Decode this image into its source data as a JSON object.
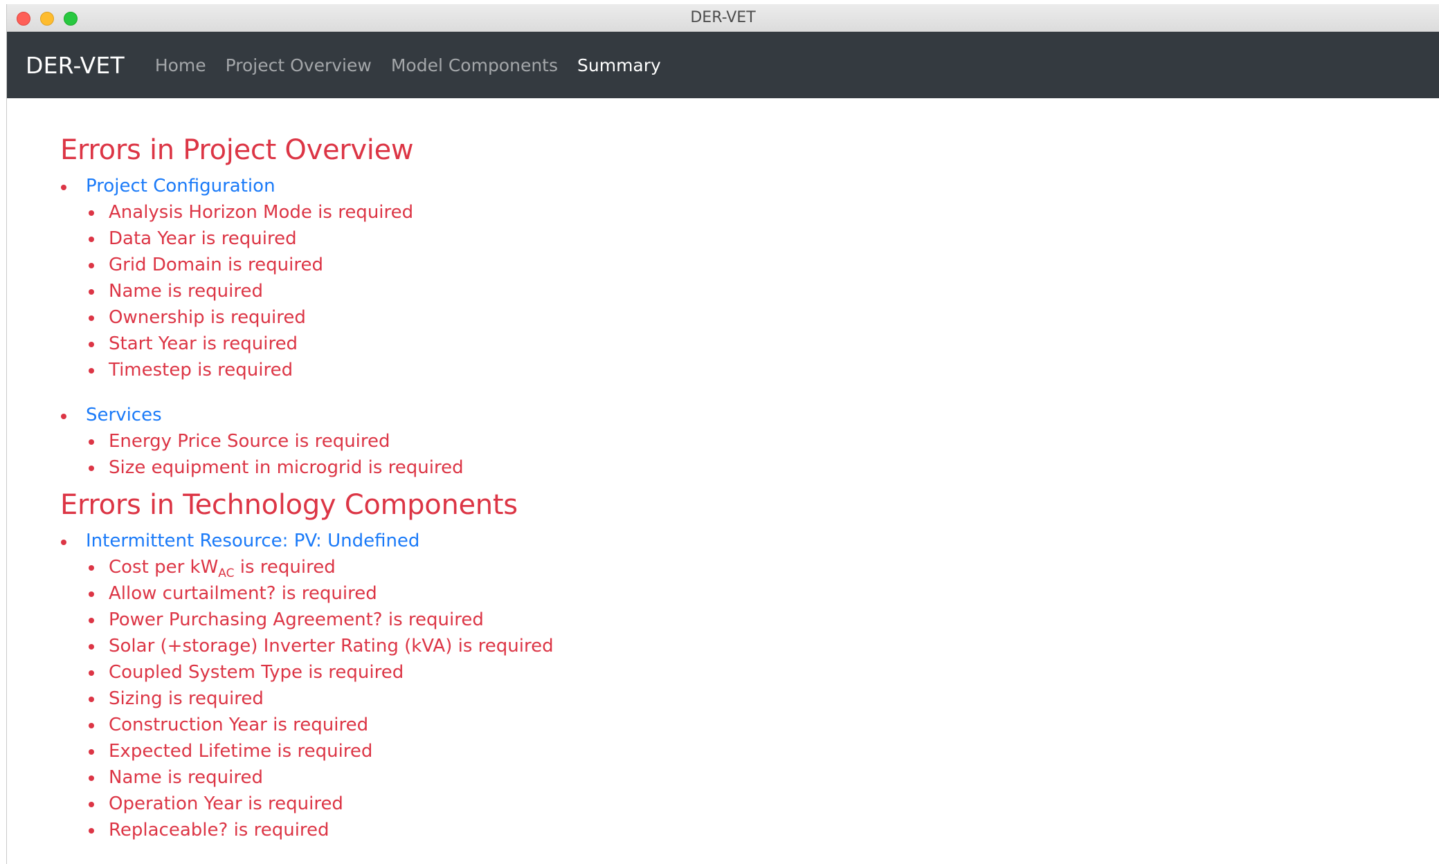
{
  "window": {
    "title": "DER-VET"
  },
  "navbar": {
    "brand": "DER-VET",
    "links": [
      "Home",
      "Project Overview",
      "Model Components",
      "Summary"
    ],
    "active": "Summary"
  },
  "project_overview": {
    "heading": "Errors in Project Overview",
    "sections": [
      {
        "name": "Project Configuration",
        "errors": [
          "Analysis Horizon Mode is required",
          "Data Year is required",
          "Grid Domain is required",
          "Name is required",
          "Ownership is required",
          "Start Year is required",
          "Timestep is required"
        ]
      },
      {
        "name": "Services",
        "errors": [
          "Energy Price Source is required",
          "Size equipment in microgrid is required"
        ]
      }
    ]
  },
  "technology_components": {
    "heading": "Errors in Technology Components",
    "sections": [
      {
        "name": "Intermittent Resource: PV: Undefined",
        "cost_error": {
          "prefix": "Cost per kW",
          "subscript": "AC",
          "suffix": " is required"
        },
        "errors": [
          "Allow curtailment? is required",
          "Power Purchasing Agreement? is required",
          "Solar (+storage) Inverter Rating (kVA) is required",
          "Coupled System Type is required",
          "Sizing is required",
          "Construction Year is required",
          "Expected Lifetime is required",
          "Name is required",
          "Operation Year is required",
          "Replaceable? is required"
        ]
      }
    ]
  }
}
